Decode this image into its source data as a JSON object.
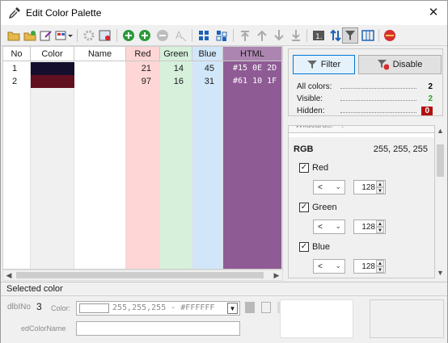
{
  "window": {
    "title": "Edit Color Palette",
    "close_glyph": "✕"
  },
  "toolbar": {
    "icons": [
      "open-folder-icon",
      "add-folder-icon",
      "edit-icon",
      "palette-dropdown-icon",
      "settings-icon",
      "image-icon",
      "add-color-icon",
      "add-icon",
      "remove-icon",
      "clear-text-icon",
      "grid-icon",
      "grid2-icon",
      "move-top-icon",
      "move-up-icon",
      "move-down-icon",
      "move-bottom-icon",
      "number-icon",
      "sort-icon",
      "filter-icon",
      "columns-icon",
      "no-entry-icon"
    ]
  },
  "grid": {
    "columns": [
      {
        "key": "no",
        "label": "No",
        "bg": "#ffffff",
        "text_bg": "#ffffff"
      },
      {
        "key": "color",
        "label": "Color",
        "bg": "#f0f0f0",
        "text_bg": "#f0f0f0"
      },
      {
        "key": "name",
        "label": "Name",
        "bg": "#ffffff",
        "text_bg": "#ffffff"
      },
      {
        "key": "red",
        "label": "Red",
        "bg": "#ffd6d6",
        "text_bg": "#ffd6d6"
      },
      {
        "key": "green",
        "label": "Green",
        "bg": "#d6f0dc",
        "text_bg": "#d6f0dc"
      },
      {
        "key": "blue",
        "label": "Blue",
        "bg": "#d2e6fa",
        "text_bg": "#d2e6fa"
      },
      {
        "key": "html",
        "label": "HTML",
        "bg": "#8e5b94",
        "text_bg": "#8e5b94"
      }
    ],
    "rows": [
      {
        "no": "1",
        "color": "#150e2d",
        "name": "",
        "red": "21",
        "green": "14",
        "blue": "45",
        "html": "#15 0E 2D"
      },
      {
        "no": "2",
        "color": "#61101f",
        "name": "",
        "red": "97",
        "green": "16",
        "blue": "31",
        "html": "#61 10 1F"
      }
    ]
  },
  "filter": {
    "filter_label": "Filter",
    "disable_label": "Disable",
    "stats": [
      {
        "label": "All colors:",
        "value": "2",
        "color": "#000000"
      },
      {
        "label": "Visible:",
        "value": "2",
        "color": "#2aa02a"
      },
      {
        "label": "Hidden:",
        "value": "0",
        "color": "#ffffff",
        "badge": "#b01010"
      }
    ]
  },
  "rgb": {
    "wildcards": "Wildcards: * ?",
    "title": "RGB",
    "value": "255, 255, 255",
    "channels": [
      {
        "label": "Red",
        "checked": "✓",
        "op": "<",
        "val": "128"
      },
      {
        "label": "Green",
        "checked": "✓",
        "op": "<",
        "val": "128"
      },
      {
        "label": "Blue",
        "checked": "✓",
        "op": "<",
        "val": "128"
      }
    ]
  },
  "selected": {
    "title": "Selected color",
    "index_label": "dlbINo",
    "index_value": "3",
    "color_label": "Color:",
    "color_text": "255,255,255 - #FFFFFF",
    "name_label": "edColorName",
    "name_value": ""
  }
}
